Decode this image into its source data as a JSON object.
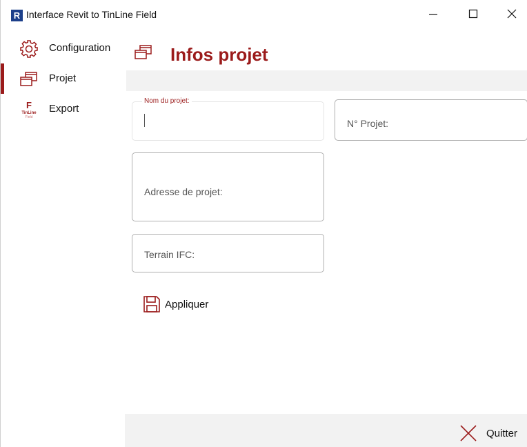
{
  "window": {
    "title": "Interface Revit to TinLine Field",
    "app_icon_letter": "R",
    "controls": [
      "minimize-icon",
      "maximize-icon",
      "close-icon"
    ]
  },
  "sidebar": {
    "items": [
      {
        "label": "Configuration",
        "icon": "gear-icon",
        "active": false
      },
      {
        "label": "Projet",
        "icon": "windows-icon",
        "active": true
      },
      {
        "label": "Export",
        "icon": "tinline-logo-icon",
        "active": false,
        "logo_letter": "F",
        "logo_text": "TinLine",
        "logo_sub": "Field"
      }
    ]
  },
  "main": {
    "title": "Infos projet",
    "title_icon": "windows-icon",
    "fields": {
      "nom_du_projet": {
        "label": "Nom du projet:",
        "value": ""
      },
      "numero_projet": {
        "placeholder": "N° Projet:",
        "value": ""
      },
      "adresse_projet": {
        "placeholder": "Adresse de projet:",
        "value": ""
      },
      "terrain_ifc": {
        "placeholder": "Terrain IFC:",
        "value": ""
      }
    },
    "apply_label": "Appliquer"
  },
  "footer": {
    "quit_label": "Quitter"
  },
  "colors": {
    "accent": "#9b1b1b",
    "header_strip": "#f2f2f2",
    "footer_bg": "#f2f2f2"
  }
}
